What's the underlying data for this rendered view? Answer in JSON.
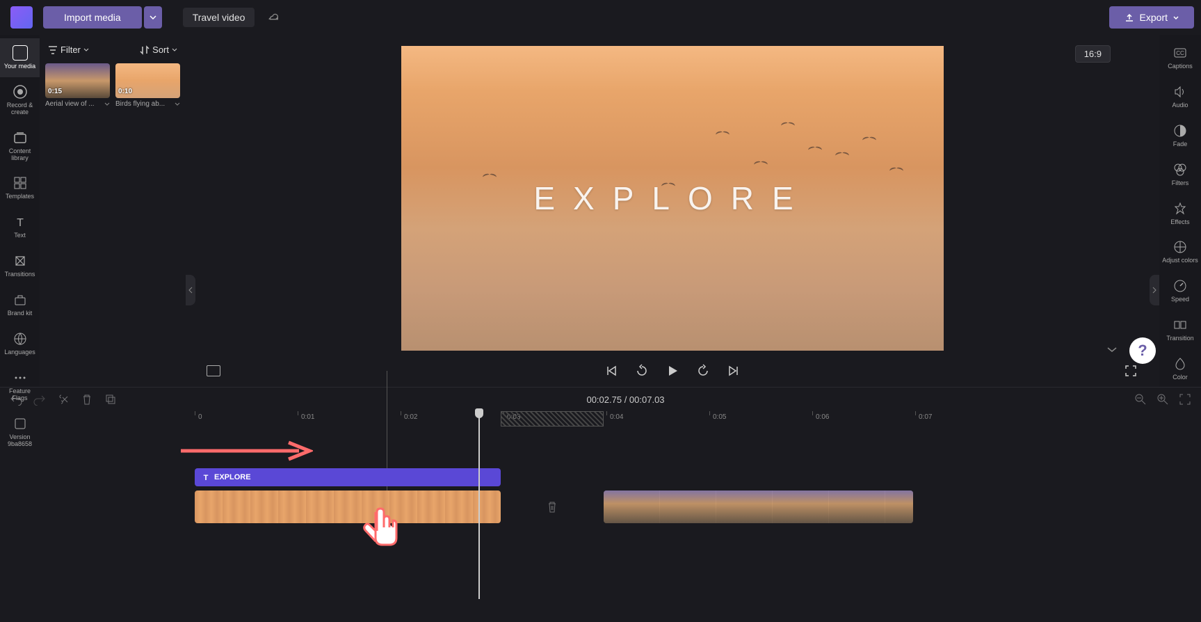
{
  "header": {
    "import_label": "Import media",
    "project_name": "Travel video",
    "export_label": "Export",
    "aspect_ratio": "16:9"
  },
  "left_sidebar": {
    "items": [
      {
        "label": "Your media"
      },
      {
        "label": "Record & create"
      },
      {
        "label": "Content library"
      },
      {
        "label": "Templates"
      },
      {
        "label": "Text"
      },
      {
        "label": "Transitions"
      },
      {
        "label": "Brand kit"
      }
    ],
    "bottom_items": [
      {
        "label": "Languages"
      },
      {
        "label": "Feature Flags"
      },
      {
        "label": "Version 9ba8658"
      }
    ]
  },
  "media_panel": {
    "filter_label": "Filter",
    "sort_label": "Sort",
    "clips": [
      {
        "duration": "0:15",
        "title": "Aerial view of ..."
      },
      {
        "duration": "0:10",
        "title": "Birds flying ab..."
      }
    ]
  },
  "preview": {
    "overlay_text": "EXPLORE"
  },
  "right_sidebar": {
    "items": [
      {
        "label": "Captions"
      },
      {
        "label": "Audio"
      },
      {
        "label": "Fade"
      },
      {
        "label": "Filters"
      },
      {
        "label": "Effects"
      },
      {
        "label": "Adjust colors"
      },
      {
        "label": "Speed"
      },
      {
        "label": "Transition"
      },
      {
        "label": "Color"
      }
    ]
  },
  "timeline": {
    "current_time": "00:02.75",
    "total_time": "00:07.03",
    "separator": " / ",
    "ruler_marks": [
      "0",
      "0:01",
      "0:02",
      "0:03",
      "0:04",
      "0:05",
      "0:06",
      "0:07"
    ],
    "text_track_label": "EXPLORE"
  }
}
